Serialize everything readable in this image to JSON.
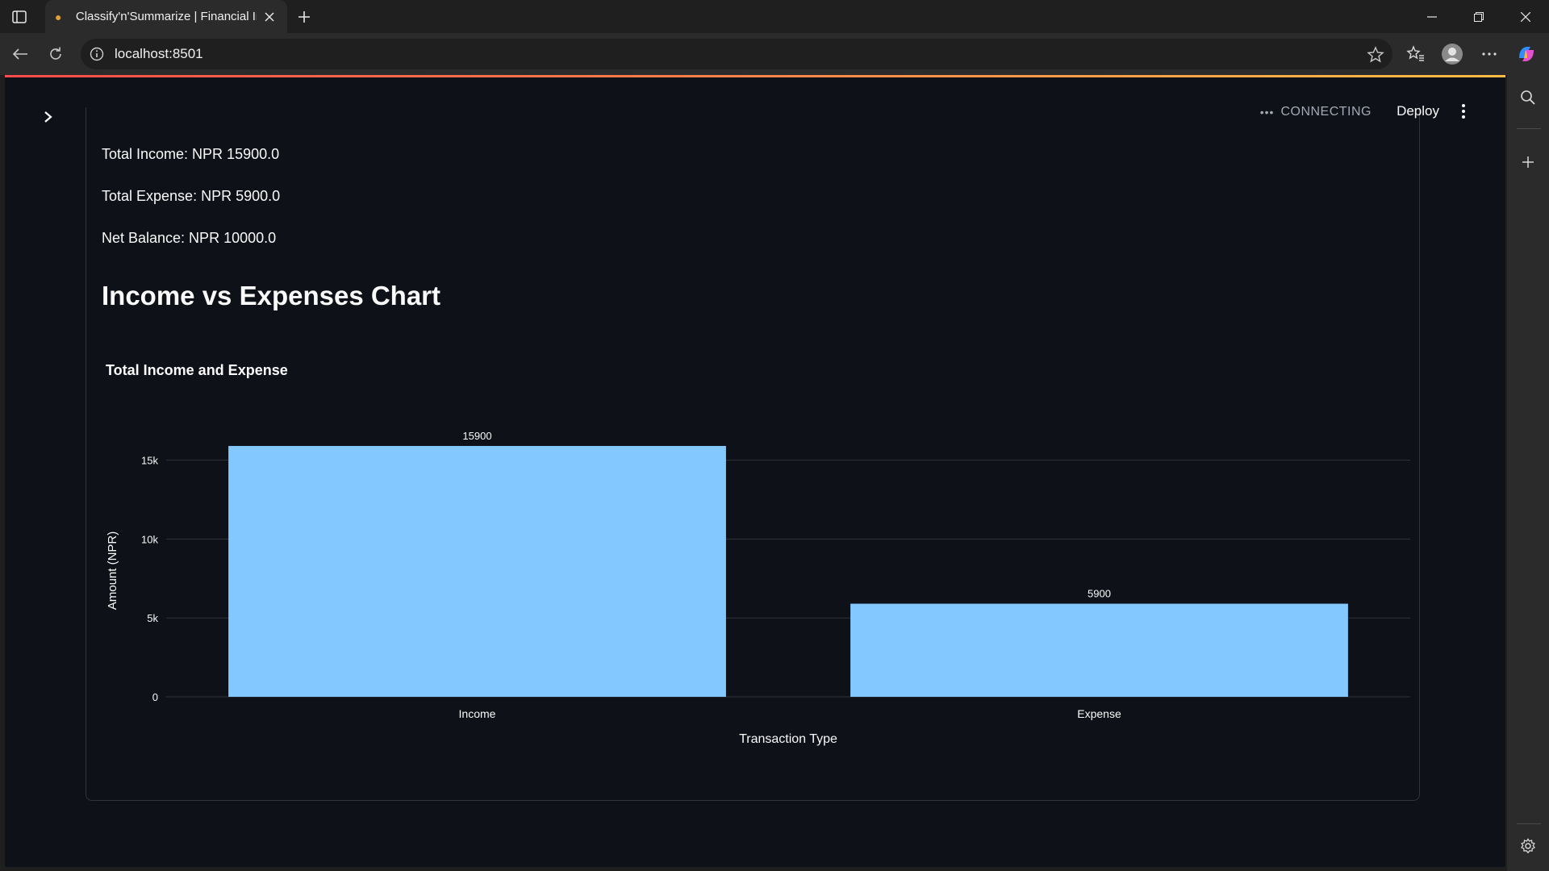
{
  "browser": {
    "tab_title": "Classify'n'Summarize | Financial Ir",
    "url": "localhost:8501"
  },
  "app": {
    "status": "CONNECTING",
    "deploy_label": "Deploy",
    "total_income": "Total Income: NPR 15900.0",
    "total_expense": "Total Expense: NPR 5900.0",
    "net_balance": "Net Balance: NPR 10000.0",
    "section_title": "Income vs Expenses Chart"
  },
  "colors": {
    "bar": "#83c9ff",
    "background": "#0e1117",
    "grid": "#31333f",
    "text": "#fafafa"
  },
  "icons": [
    "sidebar-toggle-icon",
    "new-tab-icon",
    "back-icon",
    "reload-icon",
    "info-icon",
    "star-icon",
    "favorites-icon",
    "profile-icon",
    "more-icon",
    "copilot-icon",
    "search-icon",
    "add-icon",
    "settings-icon",
    "chevron-right-icon",
    "kebab-menu-icon"
  ],
  "chart_data": {
    "type": "bar",
    "title": "Total Income and Expense",
    "categories": [
      "Income",
      "Expense"
    ],
    "values": [
      15900,
      5900
    ],
    "data_labels": [
      "15900",
      "5900"
    ],
    "xlabel": "Transaction Type",
    "ylabel": "Amount (NPR)",
    "ylim": [
      0,
      16000
    ],
    "yticks": [
      0,
      5000,
      10000,
      15000
    ],
    "ytick_labels": [
      "0",
      "5k",
      "10k",
      "15k"
    ],
    "grid": true
  }
}
